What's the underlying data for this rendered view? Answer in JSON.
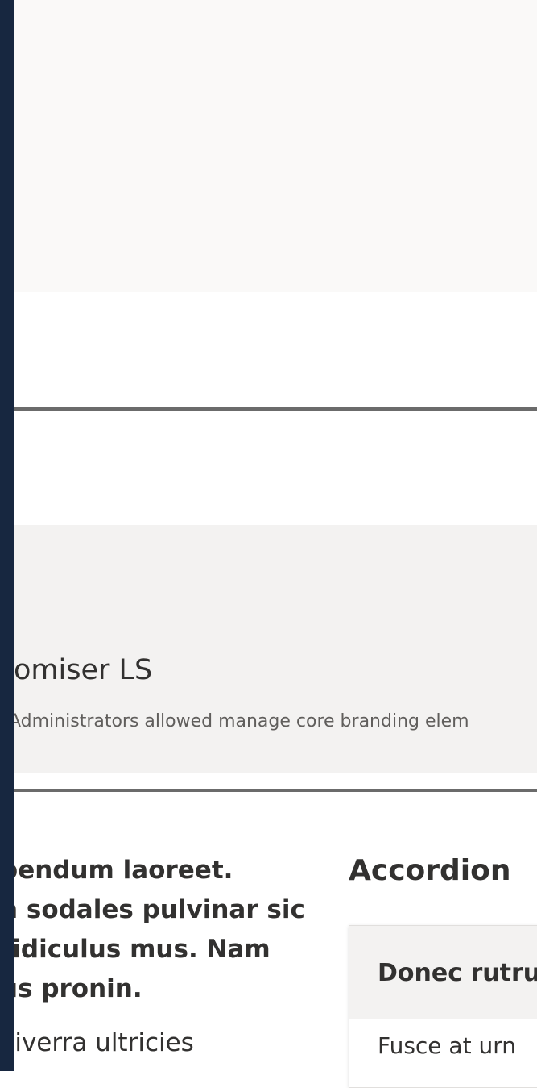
{
  "band": {
    "glyph": ")",
    "title": "omiser LS",
    "description": "Administrators allowed manage core branding elem"
  },
  "body": {
    "bold_lines": [
      "pendum laoreet.",
      "n sodales pulvinar sic",
      "ridiculus mus. Nam",
      "us pronin."
    ],
    "plain_line": "viverra ultricies"
  },
  "accordion": {
    "heading": "Accordion",
    "items": [
      {
        "title": "Donec rutru",
        "body": "Fusce at urn"
      }
    ]
  },
  "colors": {
    "rail": "#172740",
    "band": "#f3f2f1",
    "hero": "#faf9f8",
    "divider": "#6b6b6b"
  }
}
